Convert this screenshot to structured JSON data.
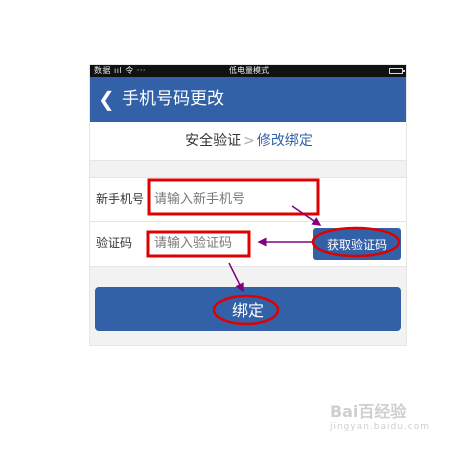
{
  "status_bar": {
    "left": "数据 ııl 令 ···",
    "center": "低电量模式"
  },
  "nav": {
    "back_icon": "chevron-left-icon",
    "title": "手机号码更改"
  },
  "steps": {
    "step1": "安全验证",
    "separator": ">",
    "step2": "修改绑定"
  },
  "form": {
    "phone_label": "新手机号",
    "phone_placeholder": "请输入新手机号",
    "code_label": "验证码",
    "code_placeholder": "请输入验证码",
    "get_code_label": "获取验证码"
  },
  "bind_button": "绑定",
  "colors": {
    "primary": "#3361a8",
    "annotation_red": "#e00000",
    "annotation_arrow": "#800080"
  },
  "watermark": {
    "main": "Bai百经验",
    "sub": "jingyan.baidu.com"
  }
}
